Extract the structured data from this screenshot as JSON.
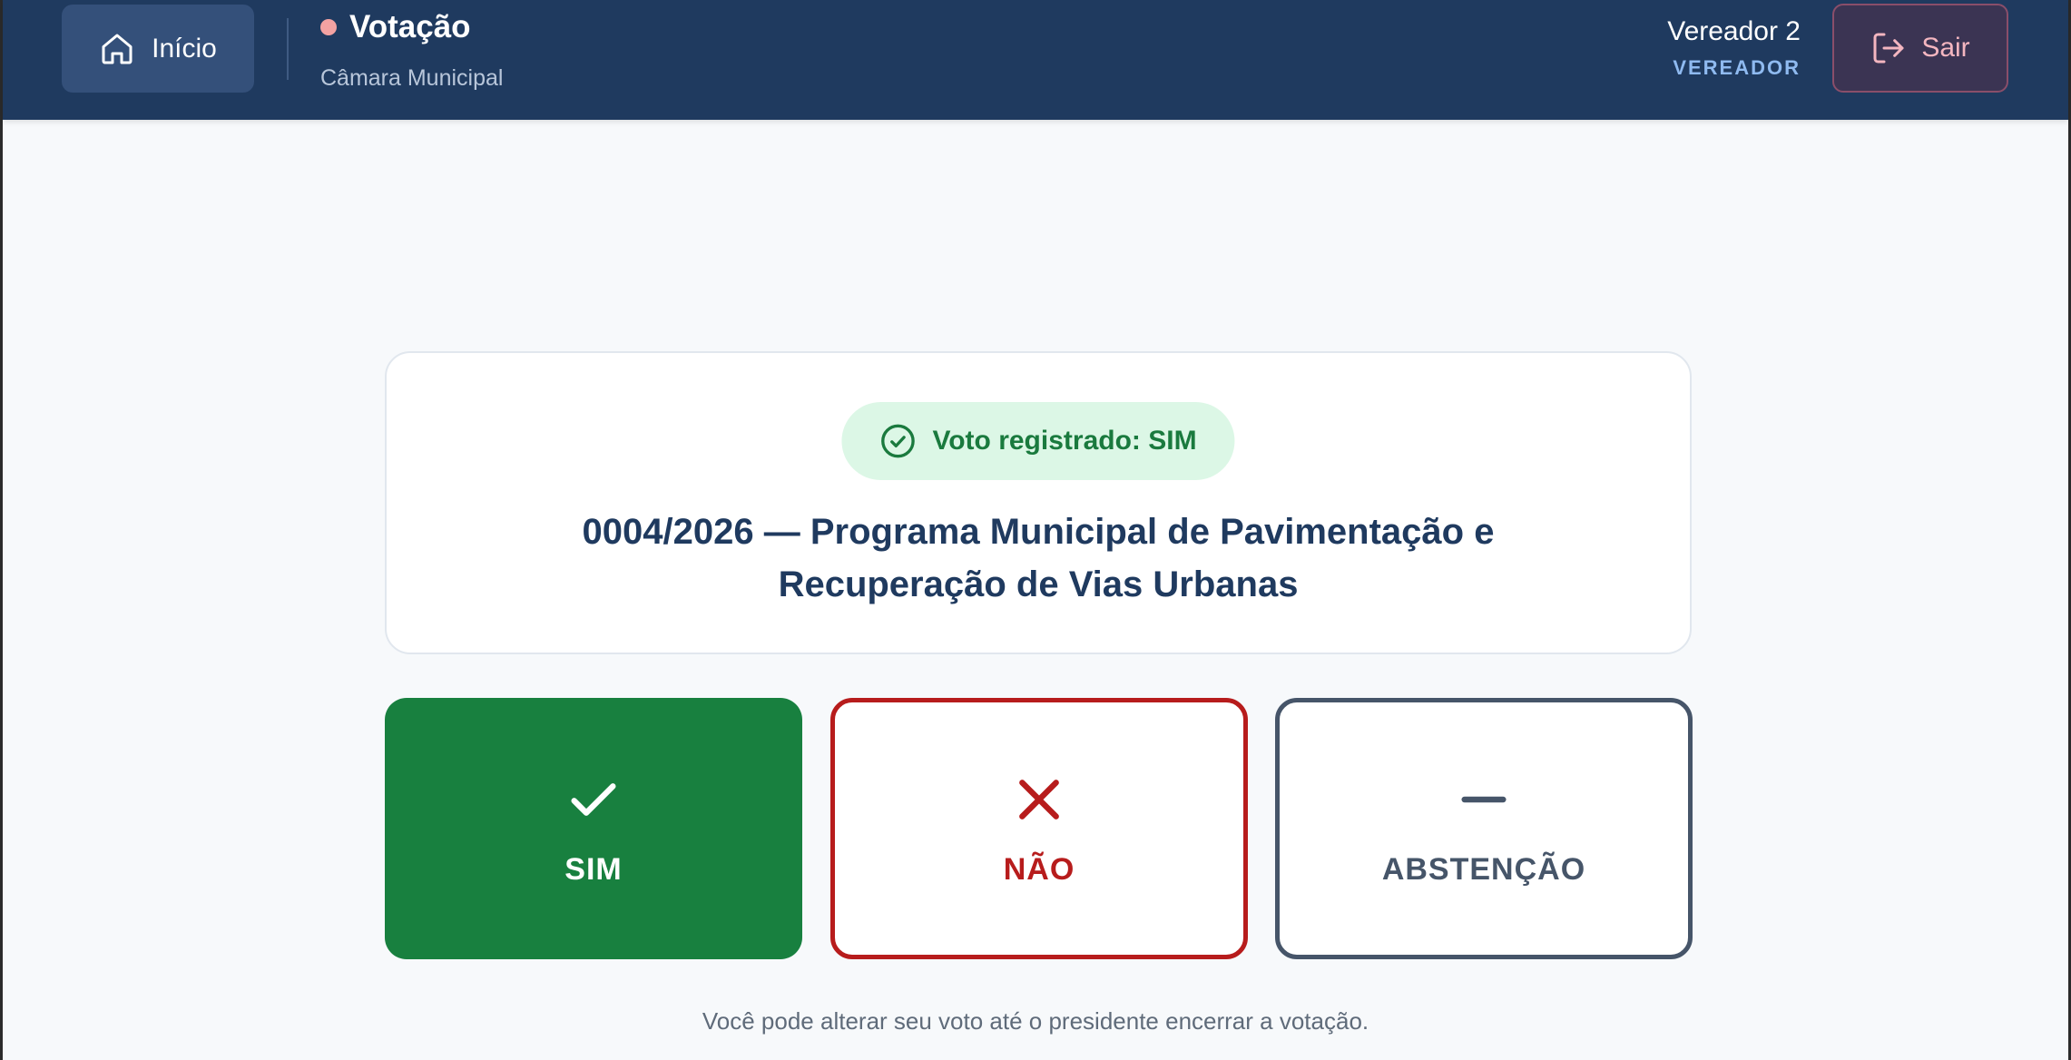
{
  "header": {
    "home_label": "Início",
    "title": "Votação",
    "subtitle": "Câmara Municipal",
    "user_name": "Vereador 2",
    "user_role": "VEREADOR",
    "logout_label": "Sair"
  },
  "proposal": {
    "vote_status": "Voto registrado: SIM",
    "title": "0004/2026 — Programa Municipal de Pavimentação e Recuperação de Vias Urbanas"
  },
  "vote_options": {
    "yes_label": "SIM",
    "no_label": "NÃO",
    "abstain_label": "ABSTENÇÃO"
  },
  "footer_note": "Você pode alterar seu voto até o presidente encerrar a votação.",
  "icons": {
    "home": "home-icon",
    "logout": "logout-icon",
    "status": "check-circle-icon",
    "yes": "check-icon",
    "no": "x-icon",
    "abstain": "minus-icon"
  },
  "colors": {
    "header_bg": "#1f3a5f",
    "yes": "#18803f",
    "no": "#b71c1c",
    "abstain": "#465569",
    "badge_bg": "#dcf7e6",
    "status_dot": "#f3a2a2"
  }
}
